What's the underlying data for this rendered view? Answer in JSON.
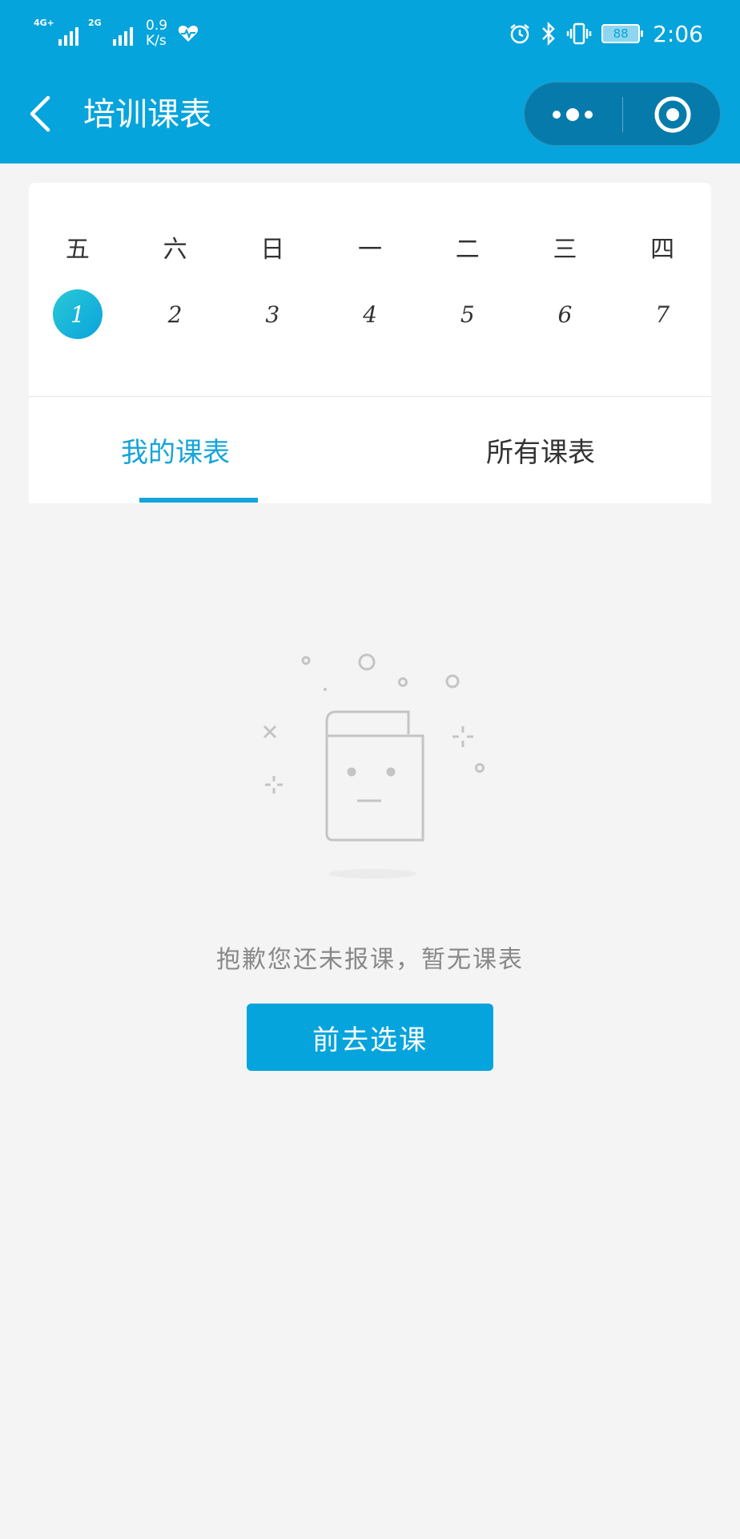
{
  "status_bar": {
    "network1": "4G+",
    "network2": "2G",
    "speed_value": "0.9",
    "speed_unit": "K/s",
    "battery": "88",
    "time": "2:06",
    "icons": [
      "signal-icon",
      "heart-rate-icon",
      "alarm-icon",
      "bluetooth-icon",
      "vibrate-icon",
      "battery-icon"
    ]
  },
  "nav": {
    "title": "培训课表",
    "back_icon": "chevron-left-icon",
    "more_icon": "more-dots-icon",
    "close_icon": "target-icon"
  },
  "calendar": {
    "weekdays": [
      "五",
      "六",
      "日",
      "一",
      "二",
      "三",
      "四"
    ],
    "dates": [
      "1",
      "2",
      "3",
      "4",
      "5",
      "6",
      "7"
    ],
    "selected_index": 0
  },
  "tabs": {
    "my_schedule": "我的课表",
    "all_schedules": "所有课表",
    "active": "my_schedule"
  },
  "empty_state": {
    "message": "抱歉您还未报课，暂无课表",
    "button_label": "前去选课",
    "illustration": "empty-book-icon"
  },
  "colors": {
    "primary": "#06a4dc",
    "capsule": "#067bab",
    "background": "#f4f4f4",
    "text": "#333333",
    "muted_text": "#888888"
  }
}
